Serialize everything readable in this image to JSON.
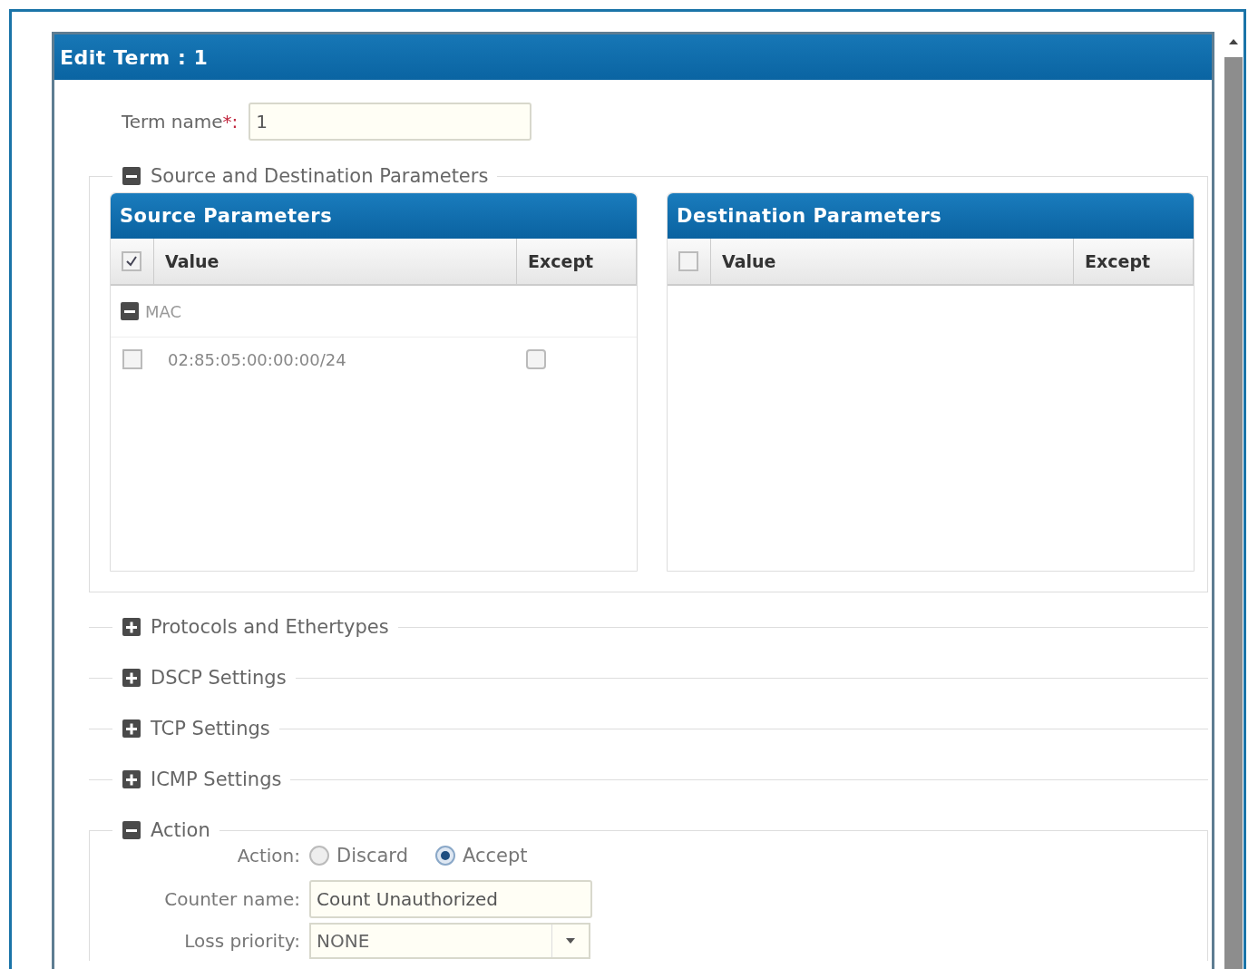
{
  "dialog": {
    "title": "Edit Term : 1"
  },
  "term_name": {
    "label": "Term name",
    "required_mark": "*:",
    "value": "1"
  },
  "sections": [
    {
      "kind": "params",
      "title": "Source and Destination Parameters",
      "expanded": true,
      "panels": [
        {
          "title": "Source Parameters",
          "all_checked": true,
          "columns": [
            "Value",
            "Except"
          ],
          "groups": [
            {
              "name": "MAC",
              "expanded": true,
              "rows": [
                {
                  "value": "02:85:05:00:00:00/24",
                  "checked": false,
                  "except": false
                }
              ]
            }
          ]
        },
        {
          "title": "Destination Parameters",
          "all_checked": false,
          "columns": [
            "Value",
            "Except"
          ]
        }
      ]
    },
    {
      "kind": "plain",
      "title": "Protocols and Ethertypes",
      "expanded": false
    },
    {
      "kind": "plain",
      "title": "DSCP Settings",
      "expanded": false
    },
    {
      "kind": "plain",
      "title": "TCP Settings",
      "expanded": false
    },
    {
      "kind": "plain",
      "title": "ICMP Settings",
      "expanded": false
    },
    {
      "kind": "action",
      "title": "Action",
      "expanded": true,
      "action": {
        "label": "Action:",
        "options": [
          {
            "label": "Discard",
            "selected": false
          },
          {
            "label": "Accept",
            "selected": true
          }
        ]
      },
      "counter": {
        "label": "Counter name:",
        "value": "Count Unauthorized"
      },
      "loss_priority": {
        "label": "Loss priority:",
        "value": "NONE"
      }
    }
  ]
}
